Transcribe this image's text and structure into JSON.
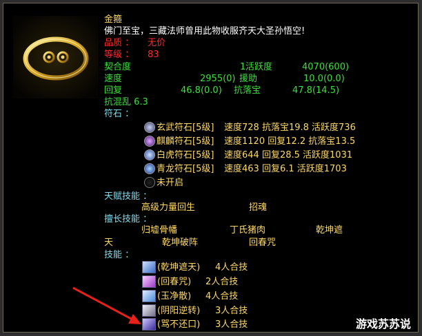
{
  "item": {
    "name": "金箍",
    "description": "佛门至宝，三藏法师曾用此物收服齐天大圣孙悟空!",
    "quality_label": "品质  ：",
    "quality_value": "无价",
    "level_label": "等级  ：",
    "level_value": "83"
  },
  "stats": {
    "fit_label": "契合度",
    "fit_value": "1",
    "active_label": "活跃度",
    "active_value": "4070(600)",
    "speed_label": "速度",
    "speed_value": "2955(0)",
    "assist_label": "援助",
    "assist_value": "10.0(0.0)",
    "recover_label": "回复",
    "recover_value": "46.8(0.0)",
    "anti_fall_label": "抗落宝",
    "anti_fall_value": "47.8(14.5)",
    "anti_chaos": "抗混乱  6.3"
  },
  "runes_label": "符石  ：",
  "runes": [
    {
      "name": "玄武符石[5级]",
      "stats": "速度728  抗落宝19.8  活跃度736",
      "color": "#8a93b8"
    },
    {
      "name": "麒麟符石[5级]",
      "stats": "速度1120  回复12.2  抗落宝13.5",
      "color": "#8f3fd6"
    },
    {
      "name": "白虎符石[5级]",
      "stats": "速度644  回复28.5  活跃度1031",
      "color": "#6f86d9"
    },
    {
      "name": "青龙符石[5级]",
      "stats": "速度463  回复6.1  活跃度1703",
      "color": "#3f6fd6"
    },
    {
      "name": "未开启",
      "stats": "",
      "color": "#444444"
    }
  ],
  "talent": {
    "label": "天赋技能  ：",
    "skill1": "高级力量回生",
    "skill2": "招魂"
  },
  "expert": {
    "label": "擅长技能  ：",
    "line1": [
      "归墟骨幡",
      "丁氏猪肉",
      "乾坤遮"
    ],
    "line2_start": "天",
    "line2": [
      "乾坤破阵",
      "回春咒"
    ]
  },
  "skills_label": "技能  ：",
  "skills": [
    {
      "name": "(乾坤遮天)",
      "combo": "4人合技",
      "color": "#5a8ad8"
    },
    {
      "name": "(回春咒)",
      "combo": "2人合技",
      "color": "#c86ad8"
    },
    {
      "name": "(玉净散)",
      "combo": "4人合技",
      "color": "#6aa8e8"
    },
    {
      "name": "(阴阳逆转)",
      "combo": "3人合技",
      "color": "#b8b8c8"
    },
    {
      "name": "(骂不还口)",
      "combo": "3人合技",
      "color": "#6a5ad8"
    }
  ],
  "watermark": "游戏苏苏说",
  "arrow_color": "#e8201a"
}
